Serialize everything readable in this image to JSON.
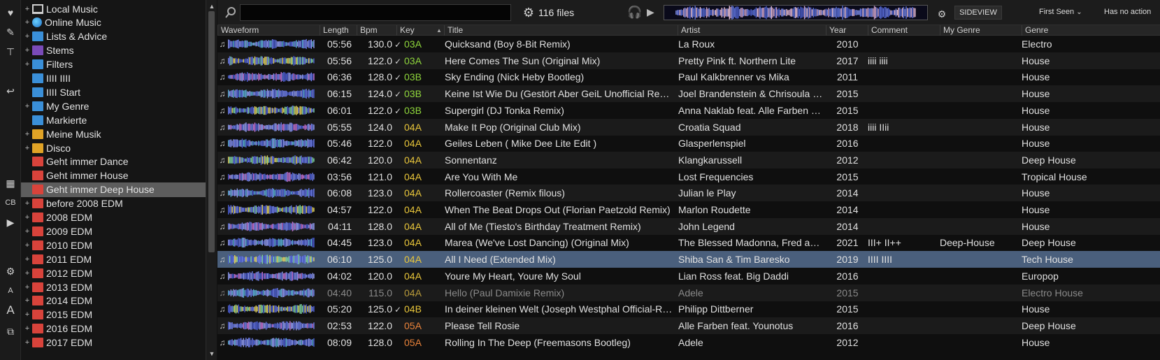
{
  "toolbar": {
    "search_placeholder": "",
    "file_count": "116 files",
    "sideview_label": "SIDEVIEW",
    "sort_label": "First Seen",
    "action_label": "Has no action"
  },
  "iconbar": {
    "items": [
      {
        "name": "add-favorite-icon",
        "glyph": "♥"
      },
      {
        "name": "edit-list-icon",
        "glyph": "✎"
      },
      {
        "name": "filter-add-icon",
        "glyph": "⊤"
      },
      {
        "name": "back-icon",
        "glyph": "↩"
      },
      {
        "name": "browser-layout-icon",
        "glyph": "▦"
      },
      {
        "name": "cb-button",
        "glyph": "CB"
      },
      {
        "name": "play-icon",
        "glyph": "▶"
      },
      {
        "name": "settings-icon",
        "glyph": "⚙"
      },
      {
        "name": "font-small-icon",
        "glyph": "A"
      },
      {
        "name": "font-large-icon",
        "glyph": "A"
      },
      {
        "name": "detach-icon",
        "glyph": "⧉"
      }
    ]
  },
  "tree": [
    {
      "label": "Local Music",
      "icon": "pc",
      "exp": "+"
    },
    {
      "label": "Online Music",
      "icon": "globe",
      "exp": "+"
    },
    {
      "label": "Lists & Advice",
      "icon": "blue",
      "exp": "+"
    },
    {
      "label": "Stems",
      "icon": "purple",
      "exp": "+"
    },
    {
      "label": "Filters",
      "icon": "blue",
      "exp": "+"
    },
    {
      "label": "IIII    IIII",
      "icon": "blue",
      "exp": ""
    },
    {
      "label": "IIII Start",
      "icon": "blue",
      "exp": ""
    },
    {
      "label": "My Genre",
      "icon": "blue",
      "exp": "+"
    },
    {
      "label": "Markierte",
      "icon": "blue",
      "exp": ""
    },
    {
      "label": "Meine Musik",
      "icon": "gold",
      "exp": "+"
    },
    {
      "label": "Disco",
      "icon": "gold",
      "exp": "+"
    },
    {
      "label": "Geht immer Dance",
      "icon": "red",
      "exp": ""
    },
    {
      "label": "Geht immer House",
      "icon": "red",
      "exp": ""
    },
    {
      "label": "Geht immer Deep House",
      "icon": "red",
      "exp": "",
      "selected": true
    },
    {
      "label": "before 2008 EDM",
      "icon": "red",
      "exp": "+"
    },
    {
      "label": "2008 EDM",
      "icon": "red",
      "exp": "+"
    },
    {
      "label": "2009 EDM",
      "icon": "red",
      "exp": "+"
    },
    {
      "label": "2010 EDM",
      "icon": "red",
      "exp": "+"
    },
    {
      "label": "2011 EDM",
      "icon": "red",
      "exp": "+"
    },
    {
      "label": "2012 EDM",
      "icon": "red",
      "exp": "+"
    },
    {
      "label": "2013 EDM",
      "icon": "red",
      "exp": "+"
    },
    {
      "label": "2014 EDM",
      "icon": "red",
      "exp": "+"
    },
    {
      "label": "2015 EDM",
      "icon": "red",
      "exp": "+"
    },
    {
      "label": "2016 EDM",
      "icon": "red",
      "exp": "+"
    },
    {
      "label": "2017 EDM",
      "icon": "red",
      "exp": "+"
    }
  ],
  "columns": [
    "Waveform",
    "Length",
    "Bpm",
    "Key",
    "Title",
    "Artist",
    "Year",
    "Comment",
    "My Genre",
    "Genre"
  ],
  "key_colors": {
    "03A": "#8fd63c",
    "03B": "#8fd63c",
    "04A": "#e8c53a",
    "04B": "#e8c53a",
    "05A": "#e8823a"
  },
  "tracks": [
    {
      "length": "05:56",
      "bpm": "130.0",
      "key": "03A",
      "checked": true,
      "title": "Quicksand (Boy 8-Bit Remix)",
      "artist": "La Roux",
      "year": "2010",
      "comment": "",
      "mygenre": "",
      "genre": "Electro"
    },
    {
      "length": "05:56",
      "bpm": "122.0",
      "key": "03A",
      "checked": true,
      "title": "Here Comes The Sun (Original Mix)",
      "artist": "Pretty Pink ft. Northern Lite",
      "year": "2017",
      "comment": "iiii    iiii",
      "mygenre": "",
      "genre": "House"
    },
    {
      "length": "06:36",
      "bpm": "128.0",
      "key": "03B",
      "checked": true,
      "title": "Sky Ending (Nick Heby Bootleg)",
      "artist": "Paul Kalkbrenner vs Mika",
      "year": "2011",
      "comment": "",
      "mygenre": "",
      "genre": "House"
    },
    {
      "length": "06:15",
      "bpm": "124.0",
      "key": "03B",
      "checked": true,
      "title": "Keine Ist Wie Du (Gestört Aber GeiL Unofficial Remix)",
      "artist": "Joel Brandenstein & Chrisoula B…",
      "year": "2015",
      "comment": "",
      "mygenre": "",
      "genre": "House"
    },
    {
      "length": "06:01",
      "bpm": "122.0",
      "key": "03B",
      "checked": true,
      "title": "Supergirl (DJ Tonka Remix)",
      "artist": "Anna Naklab feat. Alle Farben &…",
      "year": "2015",
      "comment": "",
      "mygenre": "",
      "genre": "House"
    },
    {
      "length": "05:55",
      "bpm": "124.0",
      "key": "04A",
      "checked": false,
      "title": "Make It Pop (Original Club Mix)",
      "artist": "Croatia Squad",
      "year": "2018",
      "comment": "iiii    IIii",
      "mygenre": "",
      "genre": "House"
    },
    {
      "length": "05:46",
      "bpm": "122.0",
      "key": "04A",
      "checked": false,
      "title": "Geiles Leben ( Mike Dee Lite Edit )",
      "artist": "Glasperlenspiel",
      "year": "2016",
      "comment": "",
      "mygenre": "",
      "genre": "House"
    },
    {
      "length": "06:42",
      "bpm": "120.0",
      "key": "04A",
      "checked": false,
      "title": "Sonnentanz",
      "artist": "Klangkarussell",
      "year": "2012",
      "comment": "",
      "mygenre": "",
      "genre": "Deep House"
    },
    {
      "length": "03:56",
      "bpm": "121.0",
      "key": "04A",
      "checked": false,
      "title": "Are You With Me",
      "artist": "Lost Frequencies",
      "year": "2015",
      "comment": "",
      "mygenre": "",
      "genre": "Tropical House"
    },
    {
      "length": "06:08",
      "bpm": "123.0",
      "key": "04A",
      "checked": false,
      "title": "Rollercoaster (Remix filous)",
      "artist": "Julian le Play",
      "year": "2014",
      "comment": "",
      "mygenre": "",
      "genre": "House"
    },
    {
      "length": "04:57",
      "bpm": "122.0",
      "key": "04A",
      "checked": false,
      "title": "When The Beat Drops Out (Florian Paetzold Remix)",
      "artist": "Marlon Roudette",
      "year": "2014",
      "comment": "",
      "mygenre": "",
      "genre": "House"
    },
    {
      "length": "04:11",
      "bpm": "128.0",
      "key": "04A",
      "checked": false,
      "title": "All of Me (Tiesto's Birthday Treatment Remix)",
      "artist": "John Legend",
      "year": "2014",
      "comment": "",
      "mygenre": "",
      "genre": "House"
    },
    {
      "length": "04:45",
      "bpm": "123.0",
      "key": "04A",
      "checked": false,
      "title": "Marea (We've Lost Dancing) (Original Mix)",
      "artist": "The Blessed Madonna, Fred ag…",
      "year": "2021",
      "comment": "III+    II++",
      "mygenre": "Deep-House",
      "genre": "Deep House"
    },
    {
      "length": "06:10",
      "bpm": "125.0",
      "key": "04A",
      "checked": false,
      "title": "All I Need (Extended Mix)",
      "artist": "Shiba San & Tim Baresko",
      "year": "2019",
      "comment": "IIII    IIII",
      "mygenre": "",
      "genre": "Tech House",
      "selected": true
    },
    {
      "length": "04:02",
      "bpm": "120.0",
      "key": "04A",
      "checked": false,
      "title": "Youre My Heart, Youre My Soul",
      "artist": "Lian Ross feat. Big Daddi",
      "year": "2016",
      "comment": "",
      "mygenre": "",
      "genre": "Europop"
    },
    {
      "length": "04:40",
      "bpm": "115.0",
      "key": "04A",
      "checked": false,
      "title": "Hello (Paul Damixie Remix)",
      "artist": "Adele",
      "year": "2015",
      "comment": "",
      "mygenre": "",
      "genre": "Electro House",
      "dim": true
    },
    {
      "length": "05:20",
      "bpm": "125.0",
      "key": "04B",
      "checked": true,
      "title": "In deiner kleinen Welt (Joseph Westphal Official-Remix)",
      "artist": "Philipp Dittberner",
      "year": "2015",
      "comment": "",
      "mygenre": "",
      "genre": "House"
    },
    {
      "length": "02:53",
      "bpm": "122.0",
      "key": "05A",
      "checked": false,
      "title": "Please Tell Rosie",
      "artist": "Alle Farben feat. Younotus",
      "year": "2016",
      "comment": "",
      "mygenre": "",
      "genre": "Deep House"
    },
    {
      "length": "08:09",
      "bpm": "128.0",
      "key": "05A",
      "checked": false,
      "title": "Rolling In The Deep (Freemasons Bootleg)",
      "artist": "Adele",
      "year": "2012",
      "comment": "",
      "mygenre": "",
      "genre": "House"
    }
  ]
}
